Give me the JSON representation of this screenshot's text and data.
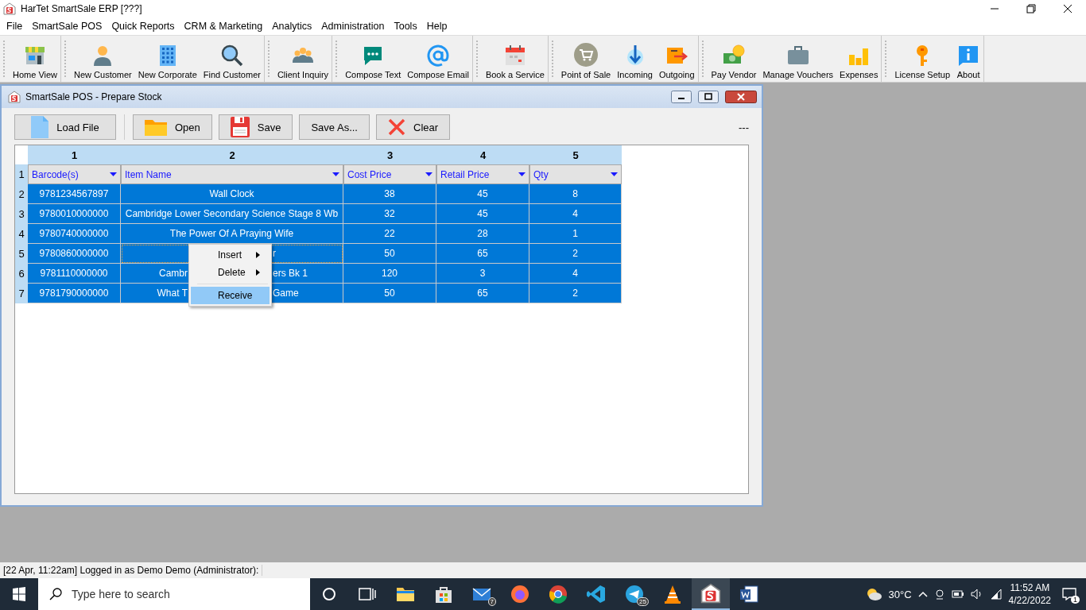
{
  "window": {
    "title": "HarTet SmartSale ERP [???]"
  },
  "menu": [
    "File",
    "SmartSale POS",
    "Quick Reports",
    "CRM & Marketing",
    "Analytics",
    "Administration",
    "Tools",
    "Help"
  ],
  "toolbar": [
    {
      "items": [
        "Home View"
      ]
    },
    {
      "items": [
        "New Customer",
        "New Corporate",
        "Find Customer"
      ]
    },
    {
      "items": [
        "Client Inquiry"
      ]
    },
    {
      "items": [
        "Compose Text",
        "Compose Email"
      ]
    },
    {
      "items": [
        "Book a Service"
      ]
    },
    {
      "items": [
        "Point of Sale",
        "Incoming",
        "Outgoing"
      ]
    },
    {
      "items": [
        "Pay Vendor",
        "Manage Vouchers",
        "Expenses"
      ]
    },
    {
      "items": [
        "License Setup",
        "About"
      ]
    }
  ],
  "child_window": {
    "title": "SmartSale POS - Prepare Stock",
    "buttons": [
      {
        "label": "Load File",
        "kind": "file"
      },
      {
        "label": "Open",
        "kind": "folder"
      },
      {
        "label": "Save",
        "kind": "disk"
      },
      {
        "label": "Save As...",
        "kind": "plain"
      },
      {
        "label": "Clear",
        "kind": "cross"
      }
    ],
    "status_text": "---",
    "grid": {
      "column_numbers": [
        "1",
        "2",
        "3",
        "4",
        "5"
      ],
      "header_row_number": "1",
      "headers": [
        "Barcode(s)",
        "Item Name",
        "Cost Price",
        "Retail Price",
        "Qty"
      ],
      "rows": [
        {
          "number": "2",
          "selected": true,
          "focused": false,
          "cells": [
            {
              "text": "9781234567897"
            },
            {
              "text": "Wall Clock"
            },
            {
              "text": "38"
            },
            {
              "text": "45"
            },
            {
              "text": "8"
            }
          ]
        },
        {
          "number": "3",
          "selected": true,
          "focused": false,
          "cells": [
            {
              "text": "9780010000000"
            },
            {
              "text": "Cambridge Lower Secondary Science Stage 8 Wb"
            },
            {
              "text": "32"
            },
            {
              "text": "45"
            },
            {
              "text": "4"
            }
          ]
        },
        {
          "number": "4",
          "selected": true,
          "focused": false,
          "cells": [
            {
              "text": "9780740000000"
            },
            {
              "text": "The Power Of A Praying Wife"
            },
            {
              "text": "22"
            },
            {
              "text": "28"
            },
            {
              "text": "1"
            }
          ]
        },
        {
          "number": "5",
          "selected": true,
          "focused": true,
          "cells": [
            {
              "text": "9780860000000"
            },
            {
              "after": "r"
            },
            {
              "text": "50"
            },
            {
              "text": "65"
            },
            {
              "text": "2"
            }
          ]
        },
        {
          "number": "6",
          "selected": true,
          "focused": false,
          "cells": [
            {
              "text": "9781110000000"
            },
            {
              "before": "Cambr",
              "after": "ers Bk 1"
            },
            {
              "text": "120"
            },
            {
              "text": "3"
            },
            {
              "text": "4"
            }
          ]
        },
        {
          "number": "7",
          "selected": true,
          "focused": false,
          "cells": [
            {
              "text": "9781790000000"
            },
            {
              "before": "What T",
              "after": "Game"
            },
            {
              "text": "50"
            },
            {
              "text": "65"
            },
            {
              "text": "2"
            }
          ]
        }
      ]
    },
    "context_menu": [
      {
        "label": "Insert",
        "submenu": true,
        "selected": false
      },
      {
        "label": "Delete",
        "submenu": true,
        "selected": false
      },
      {
        "label": "Receive",
        "submenu": false,
        "selected": true
      }
    ]
  },
  "status_bar": "[22 Apr, 11:22am] Logged in as Demo Demo (Administrator):",
  "taskbar": {
    "search_placeholder": "Type here to search",
    "apps": [
      {
        "active": false
      },
      {
        "active": false
      },
      {
        "active": false
      },
      {
        "active": false,
        "badge": "7"
      },
      {
        "active": false
      },
      {
        "active": false
      },
      {
        "active": false
      },
      {
        "active": false,
        "badge": "25"
      },
      {
        "active": false
      },
      {
        "active": true
      },
      {
        "active": false
      }
    ],
    "temperature": "30°C",
    "time": "11:52 AM",
    "date": "4/22/2022",
    "notification_count": "1"
  }
}
